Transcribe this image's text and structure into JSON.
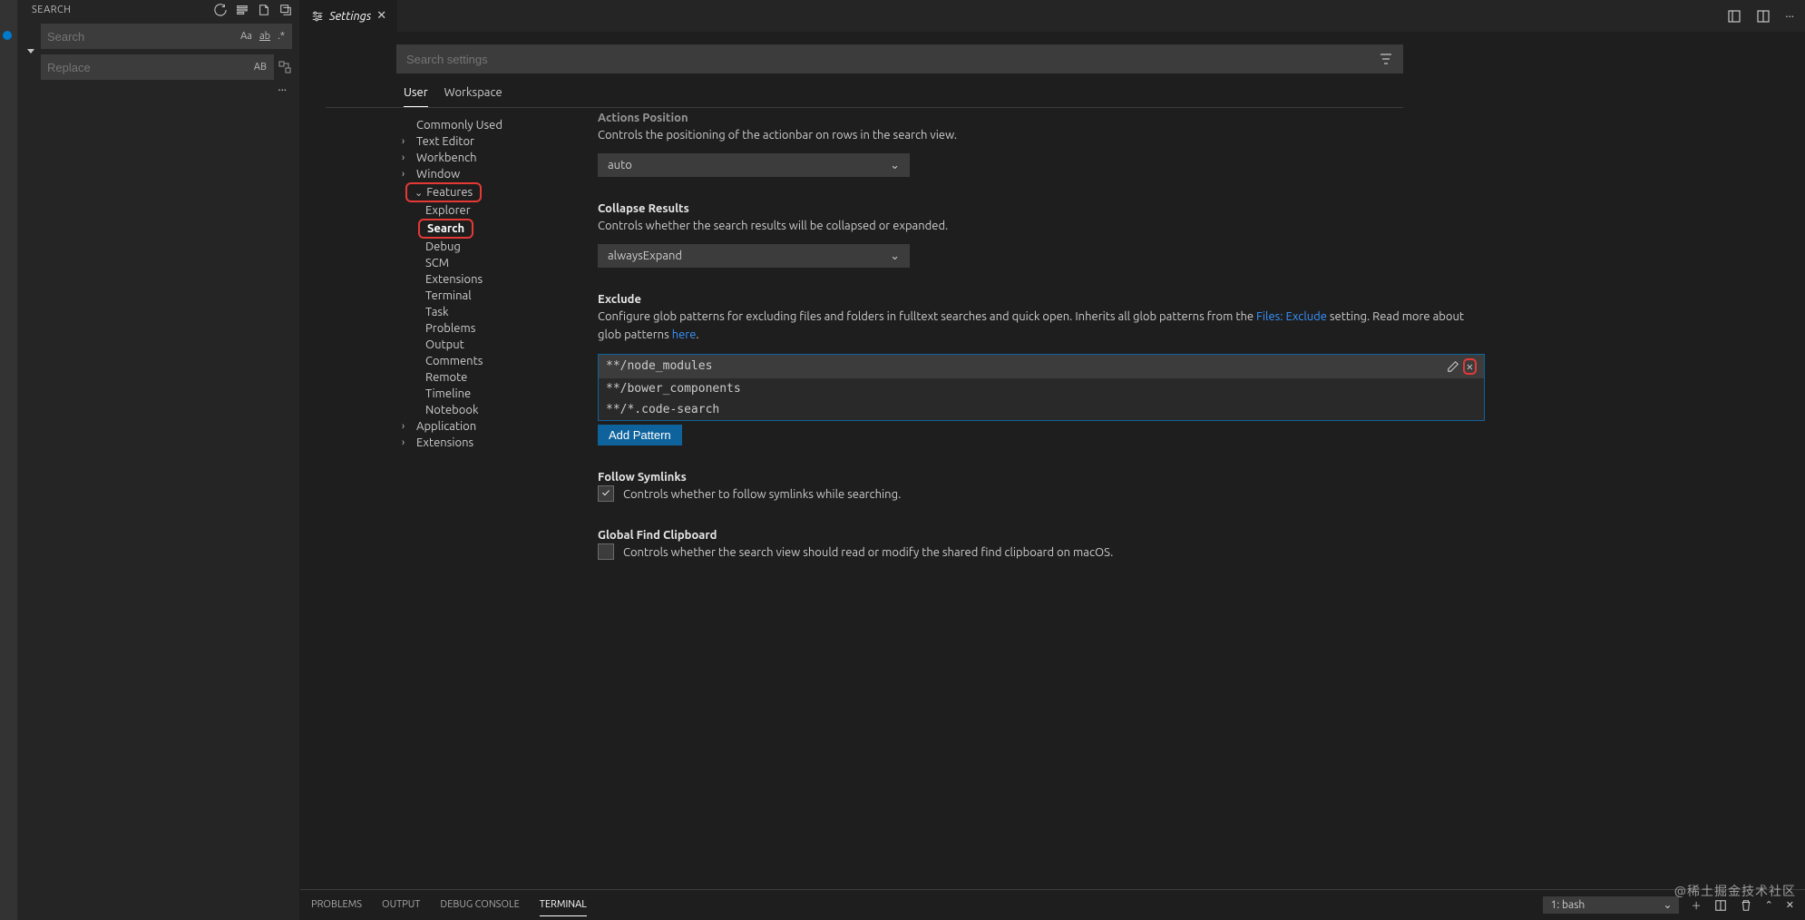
{
  "sidebar": {
    "title": "SEARCH",
    "search_placeholder": "Search",
    "replace_placeholder": "Replace",
    "match_case_label": "Aa",
    "whole_word_label": "",
    "regex_label": ".*",
    "preserve_case_label": "AB"
  },
  "tab": {
    "title": "Settings"
  },
  "settings": {
    "search_placeholder": "Search settings",
    "scopes": {
      "user": "User",
      "workspace": "Workspace"
    },
    "toc": {
      "commonly_used": "Commonly Used",
      "text_editor": "Text Editor",
      "workbench": "Workbench",
      "window": "Window",
      "features": "Features",
      "explorer": "Explorer",
      "search": "Search",
      "debug": "Debug",
      "scm": "SCM",
      "extensions_f": "Extensions",
      "terminal": "Terminal",
      "task": "Task",
      "problems": "Problems",
      "output": "Output",
      "comments": "Comments",
      "remote": "Remote",
      "timeline": "Timeline",
      "notebook": "Notebook",
      "application": "Application",
      "extensions": "Extensions"
    },
    "actions_position": {
      "title": "Actions Position",
      "desc": "Controls the positioning of the actionbar on rows in the search view.",
      "value": "auto"
    },
    "collapse_results": {
      "title": "Collapse Results",
      "desc": "Controls whether the search results will be collapsed or expanded.",
      "value": "alwaysExpand"
    },
    "exclude": {
      "title": "Exclude",
      "desc_1": "Configure glob patterns for excluding files and folders in fulltext searches and quick open. Inherits all glob patterns from the ",
      "link1": "Files: Exclude",
      "desc_2": " setting. Read more about glob patterns ",
      "link2": "here",
      "desc_3": ".",
      "patterns": [
        "**/node_modules",
        "**/bower_components",
        "**/*.code-search"
      ],
      "add_button": "Add Pattern"
    },
    "follow_symlinks": {
      "title": "Follow Symlinks",
      "desc": "Controls whether to follow symlinks while searching.",
      "checked": true
    },
    "global_find_clipboard": {
      "title": "Global Find Clipboard",
      "desc": "Controls whether the search view should read or modify the shared find clipboard on macOS.",
      "checked": false
    }
  },
  "bottom": {
    "problems": "PROBLEMS",
    "output": "OUTPUT",
    "debug_console": "DEBUG CONSOLE",
    "terminal": "TERMINAL",
    "term_selector": "1: bash"
  },
  "watermark": "@稀土掘金技术社区"
}
